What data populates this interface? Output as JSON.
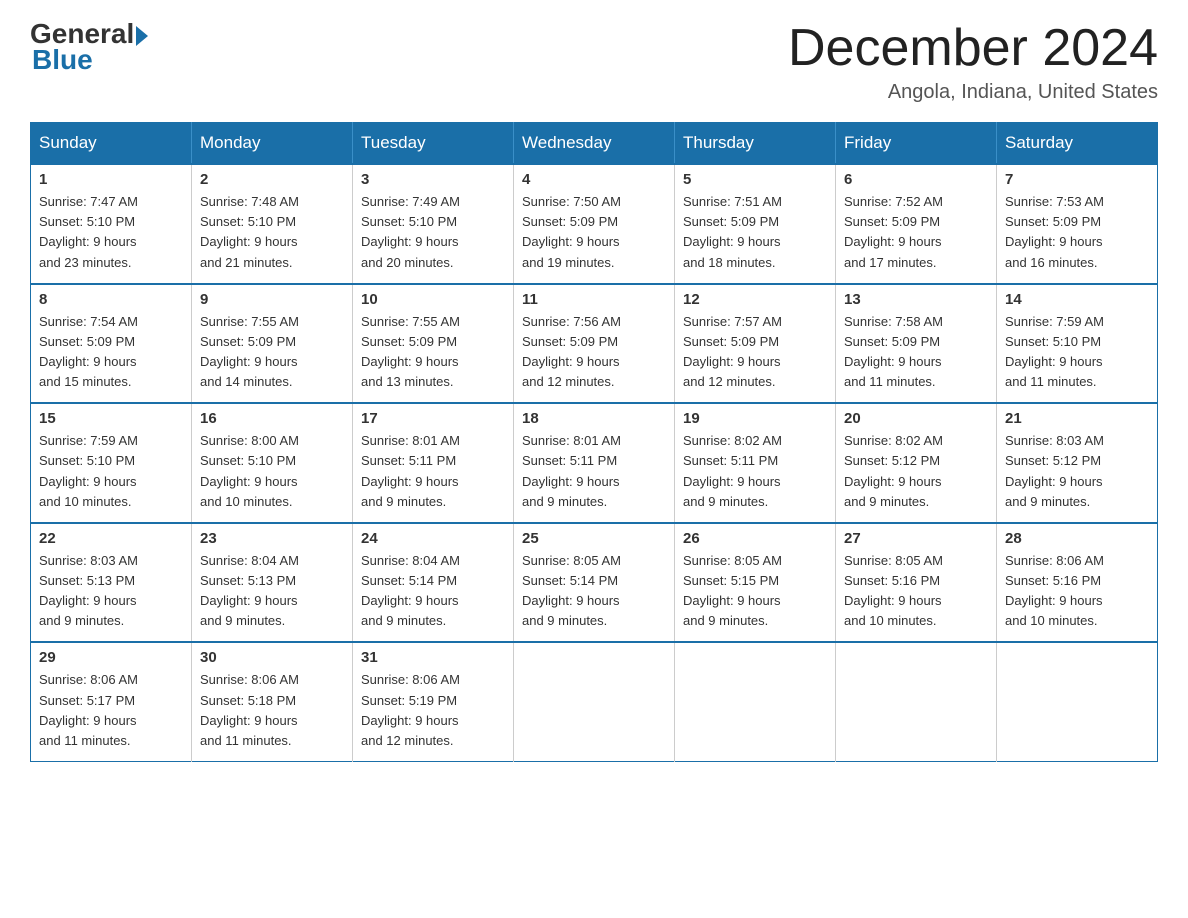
{
  "logo": {
    "general": "General",
    "blue": "Blue"
  },
  "title": "December 2024",
  "location": "Angola, Indiana, United States",
  "days_header": [
    "Sunday",
    "Monday",
    "Tuesday",
    "Wednesday",
    "Thursday",
    "Friday",
    "Saturday"
  ],
  "weeks": [
    [
      {
        "day": "1",
        "sunrise": "7:47 AM",
        "sunset": "5:10 PM",
        "daylight": "9 hours and 23 minutes."
      },
      {
        "day": "2",
        "sunrise": "7:48 AM",
        "sunset": "5:10 PM",
        "daylight": "9 hours and 21 minutes."
      },
      {
        "day": "3",
        "sunrise": "7:49 AM",
        "sunset": "5:10 PM",
        "daylight": "9 hours and 20 minutes."
      },
      {
        "day": "4",
        "sunrise": "7:50 AM",
        "sunset": "5:09 PM",
        "daylight": "9 hours and 19 minutes."
      },
      {
        "day": "5",
        "sunrise": "7:51 AM",
        "sunset": "5:09 PM",
        "daylight": "9 hours and 18 minutes."
      },
      {
        "day": "6",
        "sunrise": "7:52 AM",
        "sunset": "5:09 PM",
        "daylight": "9 hours and 17 minutes."
      },
      {
        "day": "7",
        "sunrise": "7:53 AM",
        "sunset": "5:09 PM",
        "daylight": "9 hours and 16 minutes."
      }
    ],
    [
      {
        "day": "8",
        "sunrise": "7:54 AM",
        "sunset": "5:09 PM",
        "daylight": "9 hours and 15 minutes."
      },
      {
        "day": "9",
        "sunrise": "7:55 AM",
        "sunset": "5:09 PM",
        "daylight": "9 hours and 14 minutes."
      },
      {
        "day": "10",
        "sunrise": "7:55 AM",
        "sunset": "5:09 PM",
        "daylight": "9 hours and 13 minutes."
      },
      {
        "day": "11",
        "sunrise": "7:56 AM",
        "sunset": "5:09 PM",
        "daylight": "9 hours and 12 minutes."
      },
      {
        "day": "12",
        "sunrise": "7:57 AM",
        "sunset": "5:09 PM",
        "daylight": "9 hours and 12 minutes."
      },
      {
        "day": "13",
        "sunrise": "7:58 AM",
        "sunset": "5:09 PM",
        "daylight": "9 hours and 11 minutes."
      },
      {
        "day": "14",
        "sunrise": "7:59 AM",
        "sunset": "5:10 PM",
        "daylight": "9 hours and 11 minutes."
      }
    ],
    [
      {
        "day": "15",
        "sunrise": "7:59 AM",
        "sunset": "5:10 PM",
        "daylight": "9 hours and 10 minutes."
      },
      {
        "day": "16",
        "sunrise": "8:00 AM",
        "sunset": "5:10 PM",
        "daylight": "9 hours and 10 minutes."
      },
      {
        "day": "17",
        "sunrise": "8:01 AM",
        "sunset": "5:11 PM",
        "daylight": "9 hours and 9 minutes."
      },
      {
        "day": "18",
        "sunrise": "8:01 AM",
        "sunset": "5:11 PM",
        "daylight": "9 hours and 9 minutes."
      },
      {
        "day": "19",
        "sunrise": "8:02 AM",
        "sunset": "5:11 PM",
        "daylight": "9 hours and 9 minutes."
      },
      {
        "day": "20",
        "sunrise": "8:02 AM",
        "sunset": "5:12 PM",
        "daylight": "9 hours and 9 minutes."
      },
      {
        "day": "21",
        "sunrise": "8:03 AM",
        "sunset": "5:12 PM",
        "daylight": "9 hours and 9 minutes."
      }
    ],
    [
      {
        "day": "22",
        "sunrise": "8:03 AM",
        "sunset": "5:13 PM",
        "daylight": "9 hours and 9 minutes."
      },
      {
        "day": "23",
        "sunrise": "8:04 AM",
        "sunset": "5:13 PM",
        "daylight": "9 hours and 9 minutes."
      },
      {
        "day": "24",
        "sunrise": "8:04 AM",
        "sunset": "5:14 PM",
        "daylight": "9 hours and 9 minutes."
      },
      {
        "day": "25",
        "sunrise": "8:05 AM",
        "sunset": "5:14 PM",
        "daylight": "9 hours and 9 minutes."
      },
      {
        "day": "26",
        "sunrise": "8:05 AM",
        "sunset": "5:15 PM",
        "daylight": "9 hours and 9 minutes."
      },
      {
        "day": "27",
        "sunrise": "8:05 AM",
        "sunset": "5:16 PM",
        "daylight": "9 hours and 10 minutes."
      },
      {
        "day": "28",
        "sunrise": "8:06 AM",
        "sunset": "5:16 PM",
        "daylight": "9 hours and 10 minutes."
      }
    ],
    [
      {
        "day": "29",
        "sunrise": "8:06 AM",
        "sunset": "5:17 PM",
        "daylight": "9 hours and 11 minutes."
      },
      {
        "day": "30",
        "sunrise": "8:06 AM",
        "sunset": "5:18 PM",
        "daylight": "9 hours and 11 minutes."
      },
      {
        "day": "31",
        "sunrise": "8:06 AM",
        "sunset": "5:19 PM",
        "daylight": "9 hours and 12 minutes."
      },
      null,
      null,
      null,
      null
    ]
  ]
}
